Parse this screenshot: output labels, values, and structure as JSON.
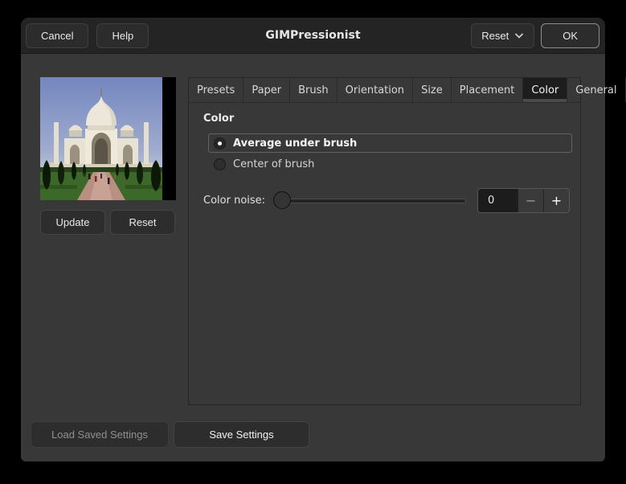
{
  "window": {
    "title": "GIMPressionist"
  },
  "headerbar": {
    "cancel_label": "Cancel",
    "help_label": "Help",
    "reset_label": "Reset",
    "ok_label": "OK"
  },
  "preview": {
    "image_description": "taj-mahal-photo-preview",
    "update_label": "Update",
    "reset_label": "Reset"
  },
  "tabs": [
    {
      "label": "Presets",
      "selected": false
    },
    {
      "label": "Paper",
      "selected": false
    },
    {
      "label": "Brush",
      "selected": false
    },
    {
      "label": "Orientation",
      "selected": false
    },
    {
      "label": "Size",
      "selected": false
    },
    {
      "label": "Placement",
      "selected": false
    },
    {
      "label": "Color",
      "selected": true
    },
    {
      "label": "General",
      "selected": false
    }
  ],
  "color_panel": {
    "heading": "Color",
    "radio_options": [
      {
        "label": "Average under brush",
        "selected": true
      },
      {
        "label": "Center of brush",
        "selected": false
      }
    ],
    "noise_label": "Color noise:",
    "noise_value": "0",
    "minus_label": "−",
    "plus_label": "+",
    "slider_position_percent": 0
  },
  "footer": {
    "load_label": "Load Saved Settings",
    "load_enabled": false,
    "save_label": "Save Settings"
  },
  "colors": {
    "titlebar_bg": "#242424",
    "content_bg": "#383838",
    "button_bg": "#2d2d2d",
    "selected_tab_bg": "#1d1d1d",
    "ok_border": "#8f8f8f",
    "text": "#e9e9e9",
    "disabled_text": "#8f8f8f",
    "entry_bg": "#1c1c1c"
  }
}
